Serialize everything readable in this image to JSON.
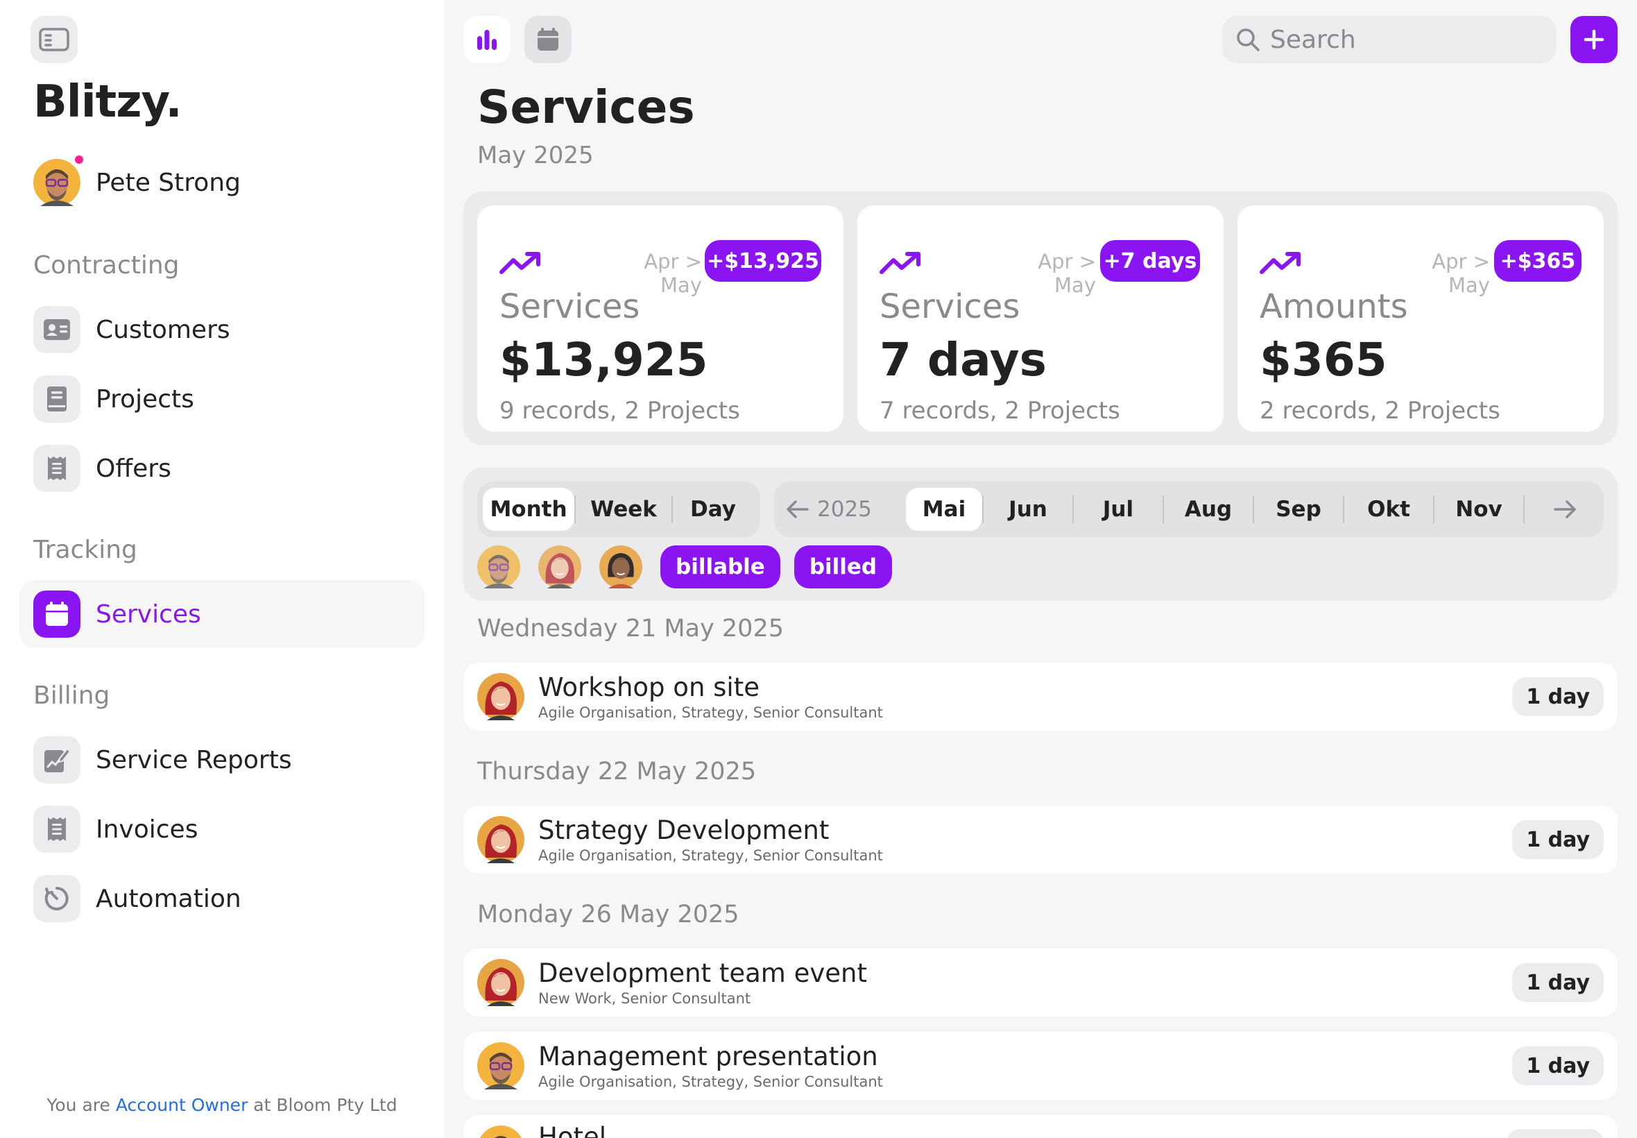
{
  "app": {
    "brand": "Blitzy.",
    "user_name": "Pete Strong"
  },
  "sidebar": {
    "sections": [
      {
        "title": "Contracting",
        "items": [
          {
            "label": "Customers",
            "icon": "id-card-icon"
          },
          {
            "label": "Projects",
            "icon": "book-icon"
          },
          {
            "label": "Offers",
            "icon": "receipt-icon"
          }
        ]
      },
      {
        "title": "Tracking",
        "items": [
          {
            "label": "Services",
            "icon": "calendar-icon",
            "active": true
          }
        ]
      },
      {
        "title": "Billing",
        "items": [
          {
            "label": "Service Reports",
            "icon": "edit-chart-icon"
          },
          {
            "label": "Invoices",
            "icon": "receipt-icon"
          },
          {
            "label": "Automation",
            "icon": "timer-icon"
          }
        ]
      }
    ],
    "footer": {
      "prefix": "You are",
      "role": "Account Owner",
      "suffix": "at Bloom Pty Ltd"
    }
  },
  "toolbar": {
    "search_placeholder": "Search",
    "view_buttons": [
      "chart-icon",
      "calendar-icon"
    ],
    "active_view": "chart-icon"
  },
  "page": {
    "title": "Services",
    "subtitle": "May 2025"
  },
  "stats": [
    {
      "period": "Apr > May",
      "delta": "+$13,925",
      "label": "Services",
      "value": "$13,925",
      "meta": "9 records, 2 Projects"
    },
    {
      "period": "Apr > May",
      "delta": "+7 days",
      "label": "Services",
      "value": "7 days",
      "meta": "7 records, 2 Projects"
    },
    {
      "period": "Apr > May",
      "delta": "+$365",
      "label": "Amounts",
      "value": "$365",
      "meta": "2 records, 2 Projects"
    }
  ],
  "filters": {
    "granularity": [
      "Month",
      "Week",
      "Day"
    ],
    "granularity_selected": "Month",
    "year": "2025",
    "months": [
      "Mai",
      "Jun",
      "Jul",
      "Aug",
      "Sep",
      "Okt",
      "Nov"
    ],
    "month_selected": "Mai",
    "tags": [
      "billable",
      "billed"
    ]
  },
  "days": [
    {
      "heading": "Wednesday 21 May 2025",
      "entries": [
        {
          "title": "Workshop on site",
          "sub": "Agile Organisation, Strategy, Senior Consultant",
          "duration": "1 day",
          "person": "woman-red"
        }
      ]
    },
    {
      "heading": "Thursday 22 May 2025",
      "entries": [
        {
          "title": "Strategy Development",
          "sub": "Agile Organisation, Strategy, Senior Consultant",
          "duration": "1 day",
          "person": "woman-red"
        }
      ]
    },
    {
      "heading": "Monday 26 May 2025",
      "entries": [
        {
          "title": "Development team event",
          "sub": "New Work, Senior Consultant",
          "duration": "1 day",
          "person": "woman-red"
        },
        {
          "title": "Management presentation",
          "sub": "Agile Organisation, Strategy, Senior Consultant",
          "duration": "1 day",
          "person": "man-glasses"
        },
        {
          "title": "Hotel",
          "sub": "",
          "duration": "",
          "person": "man-glasses"
        }
      ]
    }
  ],
  "colors": {
    "accent": "#8a15f2",
    "notification": "#ff1f8e",
    "link": "#1f6fe0"
  }
}
